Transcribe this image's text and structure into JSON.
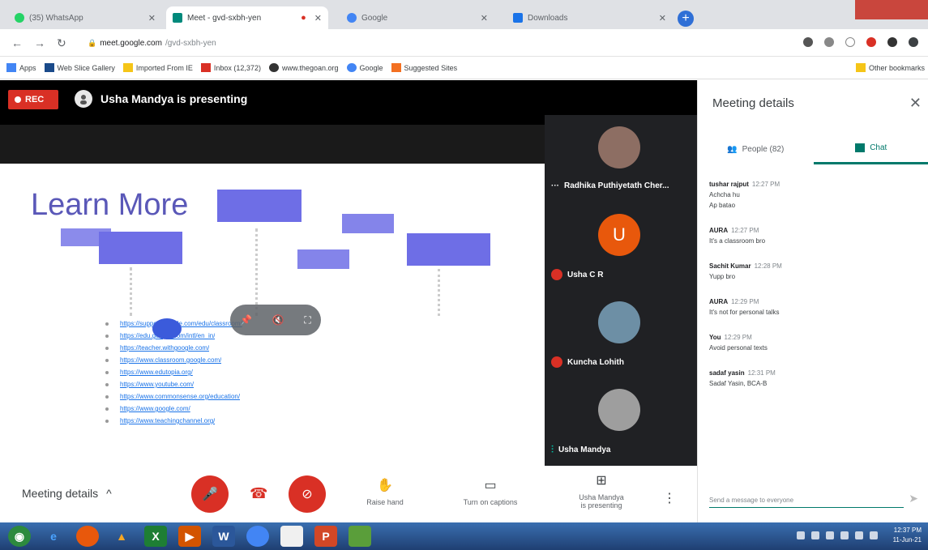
{
  "browser": {
    "tabs": [
      {
        "label": "(35) WhatsApp",
        "favicon_color": "#25d366"
      },
      {
        "label": "Meet - gvd-sxbh-yen",
        "favicon_color": "#00897b"
      },
      {
        "label": "Google",
        "favicon_color": "#4285f4"
      },
      {
        "label": "Downloads",
        "favicon_color": "#1a73e8"
      }
    ],
    "new_tab_symbol": "+",
    "url_host": "meet.google.com",
    "url_path": "/gvd-sxbh-yen",
    "bookmarks": [
      "Apps",
      "Web Slice Gallery",
      "Imported From IE",
      "Inbox (12,372)",
      "www.thegoan.org",
      "Google",
      "Suggested Sites"
    ],
    "other_bookmarks": "Other bookmarks"
  },
  "meet": {
    "rec_label": "REC",
    "presenting_banner": "Usha Mandya is presenting",
    "slide": {
      "title": "Learn More",
      "links": [
        "https://support.google.com/edu/classroom/",
        "https://edu.google.com/intl/en_in/",
        "https://teacher.withgoogle.com/",
        "https://www.classroom.google.com/",
        "https://www.edutopia.org/",
        "https://www.youtube.com/",
        "https://www.commonsense.org/education/",
        "https://www.google.com/",
        "https://www.teachingchannel.org/"
      ]
    },
    "participants": [
      {
        "name": "Radhika Puthiyetath Cher...",
        "initial": "",
        "color": "#8d6e63"
      },
      {
        "name": "Usha C R",
        "initial": "U",
        "color": "#e8580c"
      },
      {
        "name": "Kuncha Lohith",
        "initial": "",
        "color": "#6d8fa5"
      },
      {
        "name": "Usha Mandya",
        "initial": "",
        "color": "#9e9e9e"
      }
    ],
    "controls": {
      "meeting_details": "Meeting details",
      "raise_hand": "Raise hand",
      "captions": "Turn on captions",
      "presenting_line1": "Usha Mandya",
      "presenting_line2": "is presenting"
    }
  },
  "sidebar": {
    "title": "Meeting details",
    "people_tab": "People (82)",
    "chat_tab": "Chat",
    "messages": [
      {
        "sender": "tushar rajput",
        "time": "12:27 PM",
        "lines": [
          "Achcha hu",
          "Ap batao"
        ]
      },
      {
        "sender": "AURA",
        "time": "12:27 PM",
        "lines": [
          "It's a classroom bro"
        ]
      },
      {
        "sender": "Sachit Kumar",
        "time": "12:28 PM",
        "lines": [
          "Yupp bro"
        ]
      },
      {
        "sender": "AURA",
        "time": "12:29 PM",
        "lines": [
          "It's not for personal talks"
        ]
      },
      {
        "sender": "You",
        "time": "12:29 PM",
        "lines": [
          "Avoid personal texts"
        ]
      },
      {
        "sender": "sadaf yasin",
        "time": "12:31 PM",
        "lines": [
          "Sadaf Yasin, BCA-B"
        ]
      }
    ],
    "send_placeholder": "Send a message to everyone"
  },
  "taskbar": {
    "time": "12:37 PM",
    "date": "11-Jun-21"
  }
}
